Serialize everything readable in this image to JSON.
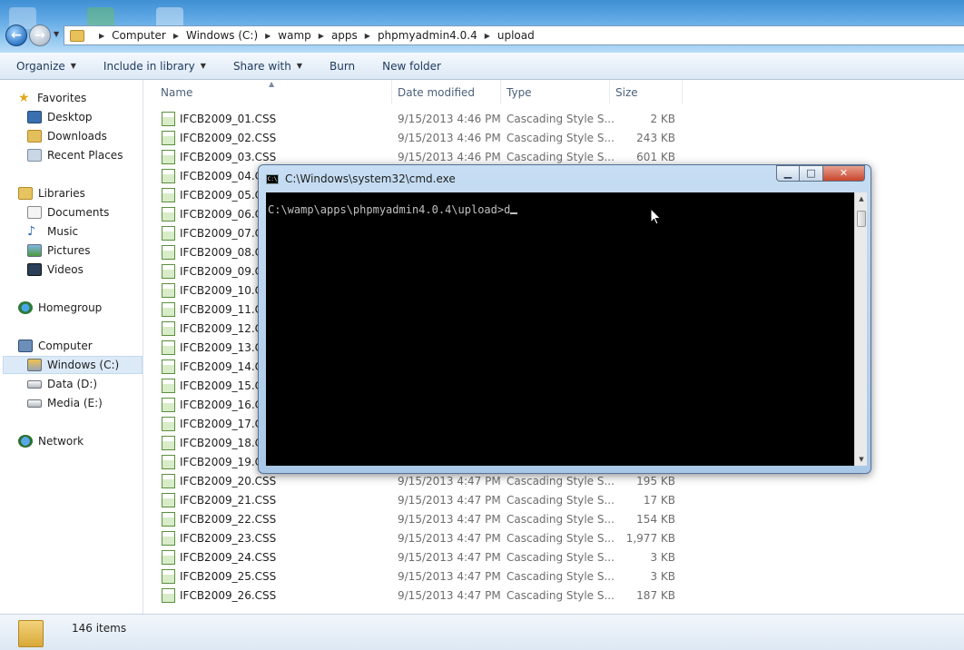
{
  "address": {
    "crumbs": [
      "Computer",
      "Windows (C:)",
      "wamp",
      "apps",
      "phpmyadmin4.0.4",
      "upload"
    ]
  },
  "toolbar": {
    "organize": "Organize",
    "include_in_library": "Include in library",
    "share_with": "Share with",
    "burn": "Burn",
    "new_folder": "New folder"
  },
  "nav": {
    "favorites": "Favorites",
    "desktop": "Desktop",
    "downloads": "Downloads",
    "recent_places": "Recent Places",
    "libraries": "Libraries",
    "documents": "Documents",
    "music": "Music",
    "pictures": "Pictures",
    "videos": "Videos",
    "homegroup": "Homegroup",
    "computer": "Computer",
    "windows_c": "Windows (C:)",
    "data_d": "Data (D:)",
    "media_e": "Media (E:)",
    "network": "Network"
  },
  "columns": {
    "name": "Name",
    "date_modified": "Date modified",
    "type": "Type",
    "size": "Size"
  },
  "files": [
    {
      "name": "IFCB2009_01.CSS",
      "date": "9/15/2013 4:46 PM",
      "type": "Cascading Style S...",
      "size": "2 KB"
    },
    {
      "name": "IFCB2009_02.CSS",
      "date": "9/15/2013 4:46 PM",
      "type": "Cascading Style S...",
      "size": "243 KB"
    },
    {
      "name": "IFCB2009_03.CSS",
      "date": "9/15/2013 4:46 PM",
      "type": "Cascading Style S...",
      "size": "601 KB"
    },
    {
      "name": "IFCB2009_04.CSS",
      "date": "",
      "type": "",
      "size": ""
    },
    {
      "name": "IFCB2009_05.CSS",
      "date": "",
      "type": "",
      "size": ""
    },
    {
      "name": "IFCB2009_06.CSS",
      "date": "",
      "type": "",
      "size": ""
    },
    {
      "name": "IFCB2009_07.CSS",
      "date": "",
      "type": "",
      "size": ""
    },
    {
      "name": "IFCB2009_08.CSS",
      "date": "",
      "type": "",
      "size": ""
    },
    {
      "name": "IFCB2009_09.CSS",
      "date": "",
      "type": "",
      "size": ""
    },
    {
      "name": "IFCB2009_10.CSS",
      "date": "",
      "type": "",
      "size": ""
    },
    {
      "name": "IFCB2009_11.CSS",
      "date": "",
      "type": "",
      "size": ""
    },
    {
      "name": "IFCB2009_12.CSS",
      "date": "",
      "type": "",
      "size": ""
    },
    {
      "name": "IFCB2009_13.CSS",
      "date": "",
      "type": "",
      "size": ""
    },
    {
      "name": "IFCB2009_14.CSS",
      "date": "",
      "type": "",
      "size": ""
    },
    {
      "name": "IFCB2009_15.CSS",
      "date": "",
      "type": "",
      "size": ""
    },
    {
      "name": "IFCB2009_16.CSS",
      "date": "",
      "type": "",
      "size": ""
    },
    {
      "name": "IFCB2009_17.CSS",
      "date": "",
      "type": "",
      "size": ""
    },
    {
      "name": "IFCB2009_18.CSS",
      "date": "",
      "type": "",
      "size": ""
    },
    {
      "name": "IFCB2009_19.CSS",
      "date": "",
      "type": "",
      "size": ""
    },
    {
      "name": "IFCB2009_20.CSS",
      "date": "9/15/2013 4:47 PM",
      "type": "Cascading Style S...",
      "size": "195 KB"
    },
    {
      "name": "IFCB2009_21.CSS",
      "date": "9/15/2013 4:47 PM",
      "type": "Cascading Style S...",
      "size": "17 KB"
    },
    {
      "name": "IFCB2009_22.CSS",
      "date": "9/15/2013 4:47 PM",
      "type": "Cascading Style S...",
      "size": "154 KB"
    },
    {
      "name": "IFCB2009_23.CSS",
      "date": "9/15/2013 4:47 PM",
      "type": "Cascading Style S...",
      "size": "1,977 KB"
    },
    {
      "name": "IFCB2009_24.CSS",
      "date": "9/15/2013 4:47 PM",
      "type": "Cascading Style S...",
      "size": "3 KB"
    },
    {
      "name": "IFCB2009_25.CSS",
      "date": "9/15/2013 4:47 PM",
      "type": "Cascading Style S...",
      "size": "3 KB"
    },
    {
      "name": "IFCB2009_26.CSS",
      "date": "9/15/2013 4:47 PM",
      "type": "Cascading Style S...",
      "size": "187 KB"
    }
  ],
  "status": {
    "item_count": "146 items"
  },
  "cmd": {
    "title": "C:\\Windows\\system32\\cmd.exe",
    "icon_text": "C:\\",
    "prompt": "C:\\wamp\\apps\\phpmyadmin4.0.4\\upload>d",
    "minimize": "▁",
    "maximize": "□",
    "close": "✕"
  },
  "colors": {
    "accent": "#3f8fd4",
    "close_button": "#c9452c",
    "console_bg": "#000000",
    "console_text": "#c0c0c0"
  }
}
